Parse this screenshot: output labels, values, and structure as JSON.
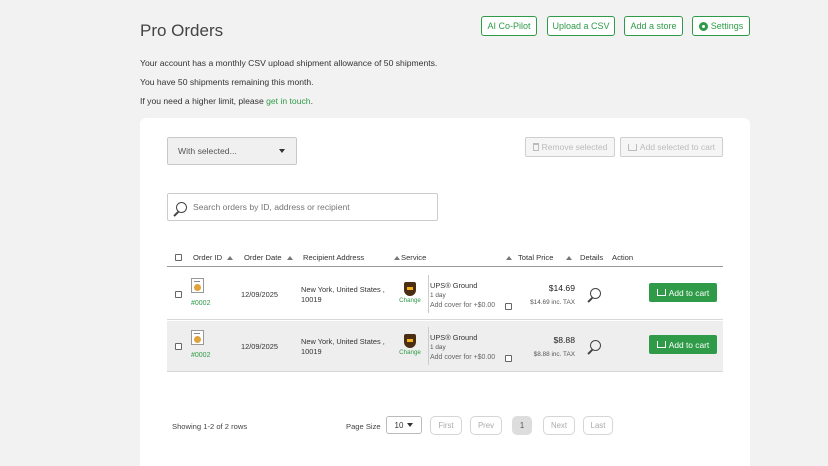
{
  "page": {
    "title": "Pro Orders"
  },
  "top_buttons": {
    "ai_copilot": "AI Co-Pilot",
    "upload_csv": "Upload a CSV",
    "add_store": "Add a store",
    "settings": "Settings"
  },
  "info": {
    "line1": "Your account has a monthly CSV upload shipment allowance of 50 shipments.",
    "line2": "You have 50 shipments remaining this month.",
    "line3_prefix": "If you need a higher limit, please ",
    "line3_link": "get in touch",
    "line3_suffix": "."
  },
  "toolbar": {
    "with_selected": "With selected...",
    "remove_selected": "Remove selected",
    "add_selected": "Add selected to cart"
  },
  "search": {
    "placeholder": "Search orders by ID, address or recipient"
  },
  "table": {
    "headers": {
      "order_id": "Order ID",
      "order_date": "Order Date",
      "recipient": "Recipient Address",
      "service": "Service",
      "total": "Total Price",
      "details": "Details",
      "action": "Action"
    },
    "rows": [
      {
        "order_id": "#0002",
        "date": "12/09/2025",
        "address_line1": "New York, United States ,",
        "address_line2": "10019",
        "change": "Change",
        "service_name": "UPS® Ground",
        "service_days": "1 day",
        "cover": "Add cover for +$0.00",
        "price": "$14.69",
        "tax": "$14.69 inc. TAX",
        "action": "Add to cart"
      },
      {
        "order_id": "#0002",
        "date": "12/09/2025",
        "address_line1": "New York, United States ,",
        "address_line2": "10019",
        "change": "Change",
        "service_name": "UPS® Ground",
        "service_days": "1 day",
        "cover": "Add cover for +$0.00",
        "price": "$8.88",
        "tax": "$8.88 inc. TAX",
        "action": "Add to cart"
      }
    ]
  },
  "footer": {
    "showing": "Showing 1-2 of 2 rows",
    "page_size_label": "Page Size",
    "page_size_value": "10",
    "first": "First",
    "prev": "Prev",
    "current_page": "1",
    "next": "Next",
    "last": "Last"
  },
  "colors": {
    "accent": "#2f9b48",
    "background": "#f2f2f2"
  }
}
